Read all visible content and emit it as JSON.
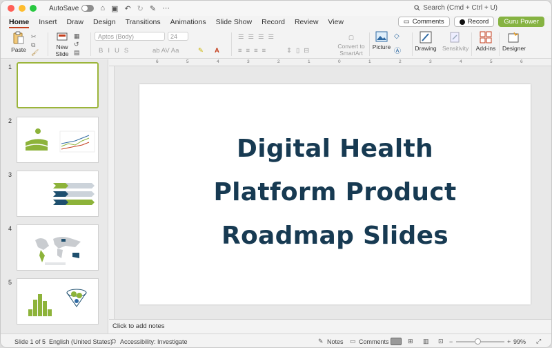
{
  "titlebar": {
    "autosave_label": "AutoSave",
    "search_label": "Search (Cmd + Ctrl + U)"
  },
  "tabs": [
    "Home",
    "Insert",
    "Draw",
    "Design",
    "Transitions",
    "Animations",
    "Slide Show",
    "Record",
    "Review",
    "View"
  ],
  "actions": {
    "comments": "Comments",
    "record": "Record",
    "guru": "Guru Power"
  },
  "ribbon": {
    "paste": "Paste",
    "new_slide_1": "New",
    "new_slide_2": "Slide",
    "font_name": "Aptos (Body)",
    "font_size": "24",
    "convert_1": "Convert to",
    "convert_2": "SmartArt",
    "picture": "Picture",
    "drawing": "Drawing",
    "sensitivity": "Sensitivity",
    "addins": "Add-ins",
    "designer": "Designer"
  },
  "thumbnails": [
    "1",
    "2",
    "3",
    "4",
    "5"
  ],
  "slide": {
    "title_lines": [
      "Digital Health",
      "Platform Product",
      "Roadmap Slides"
    ]
  },
  "notes_placeholder": "Click to add notes",
  "status": {
    "slide_count": "Slide 1 of 5",
    "language": "English (United States)",
    "accessibility": "Accessibility: Investigate",
    "notes": "Notes",
    "comments": "Comments",
    "zoom": "99%"
  },
  "colors": {
    "accent": "#c43e1c",
    "brand_green": "#86b342",
    "title_navy": "#173a52"
  }
}
